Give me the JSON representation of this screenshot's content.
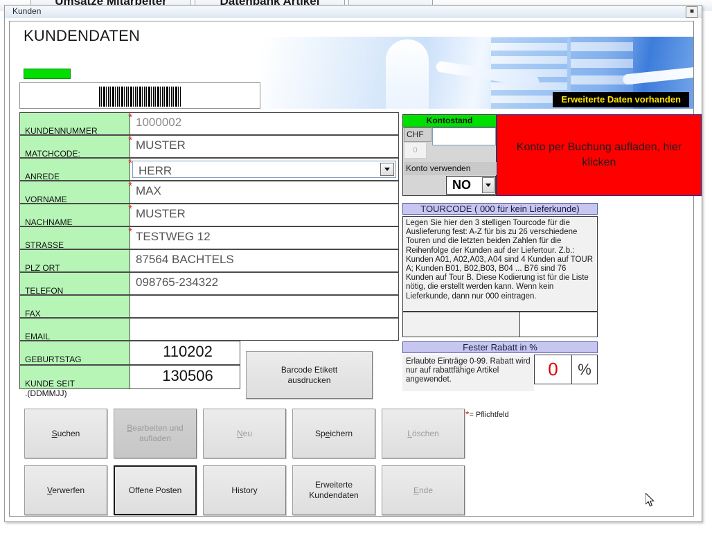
{
  "background_tabs": [
    {
      "label": "Umsätze Mitarbeiter"
    },
    {
      "label": "Datenbank Artikel"
    },
    {
      "label": ""
    }
  ],
  "window": {
    "caption": "Kunden",
    "close_icon": "close-icon"
  },
  "header": {
    "title": "KUNDENDATEN",
    "banner": "Erweiterte Daten vorhanden",
    "status_bar_color": "#00dd00",
    "barcode_label": ""
  },
  "form": {
    "fields": [
      {
        "label": "KUNDENNUMMER",
        "value": "1000002",
        "required": true,
        "type": "text",
        "readonly": true
      },
      {
        "label": "MATCHCODE:",
        "value": "MUSTER",
        "required": true,
        "type": "text"
      },
      {
        "label": "ANREDE",
        "value": "HERR",
        "required": true,
        "type": "combo"
      },
      {
        "label": "VORNAME",
        "value": "MAX",
        "required": true,
        "type": "text"
      },
      {
        "label": "NACHNAME",
        "value": "MUSTER",
        "required": true,
        "type": "text"
      },
      {
        "label": "STRASSE",
        "value": "TESTWEG 12",
        "required": true,
        "type": "text"
      },
      {
        "label": "PLZ ORT",
        "value": "87564 BACHTELS",
        "required": false,
        "type": "text"
      },
      {
        "label": "TELEFON",
        "value": "098765-234322",
        "required": false,
        "type": "text"
      },
      {
        "label": "FAX",
        "value": "",
        "required": false,
        "type": "text"
      },
      {
        "label": "EMAIL",
        "value": "",
        "required": false,
        "type": "text"
      },
      {
        "label": "GEBURTSTAG\n.(DDMMJJ)",
        "value": "110202",
        "required": false,
        "type": "numeric"
      },
      {
        "label": "KUNDE SEIT\n.(DDMMJJ)",
        "value": "130506",
        "required": false,
        "type": "numeric"
      }
    ],
    "barcode_button": "Barcode Etikett\nausdrucken"
  },
  "kontostand": {
    "title": "Kontostand",
    "currency": "CHF",
    "zero": "0",
    "amount": "",
    "use_label": "Konto verwenden",
    "use_value": "NO",
    "title_color": "#00e000"
  },
  "recharge": {
    "label": "Konto per Buchung aufladen, hier klicken",
    "color": "#fe0000"
  },
  "tourcode": {
    "header": "TOURCODE ( 000 für kein Lieferkunde)",
    "help": "Legen Sie hier den 3 stelligen Tourcode für die Auslieferung fest: A-Z für bis zu 26 verschiedene Touren  und die letzten beiden Zahlen für die Reihenfolge der Kunden auf der Liefertour. Z.b.: Kunden A01, A02,A03, A04 sind 4 Kunden auf TOUR A; Kunden B01, B02,B03, B04 ...  B76 sind 76 Kunden auf Tour B. Diese Kodierung ist für die Liste nötig, die erstellt werden kann. Wenn kein Lieferkunde, dann nur 000 eintragen.",
    "value": ""
  },
  "rabatt": {
    "header": "Fester Rabatt in %",
    "note": "Erlaubte Einträge 0-99. Rabatt wird nur auf rabattfähige Artikel angewendet.",
    "value": "0",
    "unit": "%"
  },
  "buttons_row1": [
    {
      "label": "Suchen",
      "mnemonic": "S",
      "state": "normal"
    },
    {
      "label": "Bearbeiten und aufladen",
      "mnemonic": "B",
      "state": "disabled-pressed"
    },
    {
      "label": "Neu",
      "mnemonic": "N",
      "state": "disabled"
    },
    {
      "label": "Speichern",
      "mnemonic": "e",
      "state": "normal"
    },
    {
      "label": "Löschen",
      "mnemonic": "L",
      "state": "disabled"
    }
  ],
  "buttons_row2": [
    {
      "label": "Verwerfen",
      "mnemonic": "V",
      "state": "normal"
    },
    {
      "label": "Offene Posten",
      "mnemonic": "",
      "state": "focused"
    },
    {
      "label": "History",
      "mnemonic": "",
      "state": "normal"
    },
    {
      "label": "Erweiterte Kundendaten",
      "mnemonic": "",
      "state": "normal"
    },
    {
      "label": "Ende",
      "mnemonic": "E",
      "state": "disabled"
    }
  ],
  "legend": {
    "text": "= Pflichtfeld",
    "marker": "*"
  }
}
